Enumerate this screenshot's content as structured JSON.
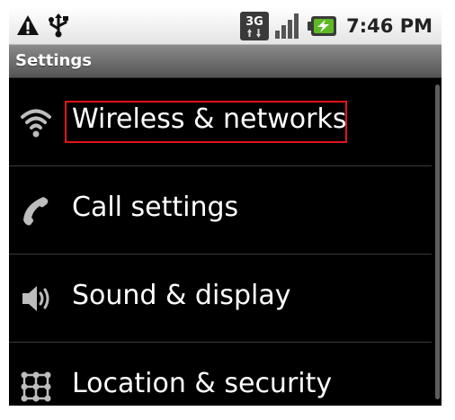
{
  "status_bar": {
    "icons_left": [
      "warning-icon",
      "usb-icon"
    ],
    "network_label": "3G",
    "icons_right": [
      "3g-data-icon",
      "signal-strength-icon",
      "battery-charging-icon"
    ],
    "time": "7:46 PM",
    "battery_color": "#5fb924"
  },
  "title_bar": {
    "title": "Settings"
  },
  "settings": {
    "items": [
      {
        "label": "Wireless & networks",
        "icon": "wifi-icon",
        "highlighted": true
      },
      {
        "label": "Call settings",
        "icon": "phone-handset-icon"
      },
      {
        "label": "Sound & display",
        "icon": "speaker-icon"
      },
      {
        "label": "Location & security",
        "icon": "location-grid-icon"
      }
    ]
  },
  "colors": {
    "highlight_border": "#e0141c",
    "list_background": "#000000"
  }
}
